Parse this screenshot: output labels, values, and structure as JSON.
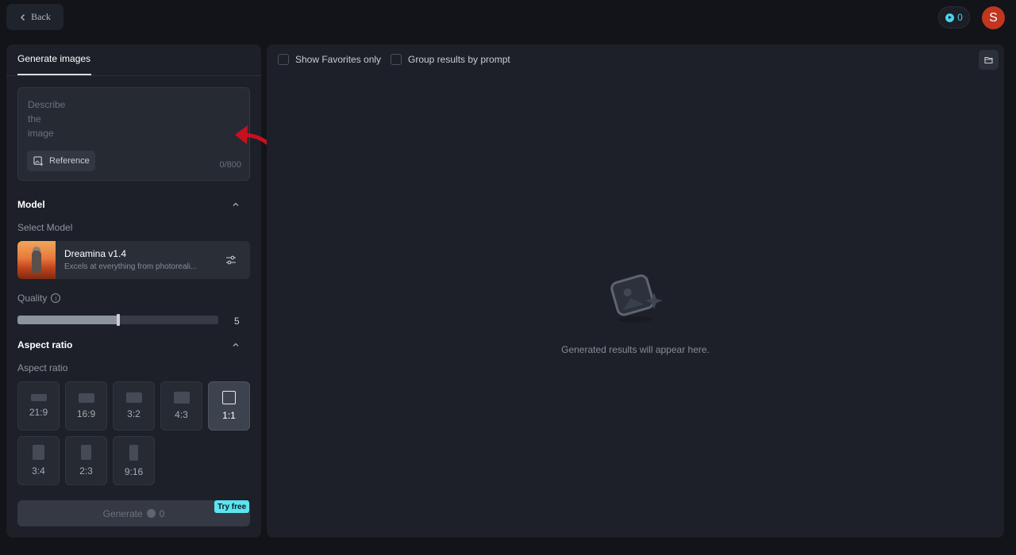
{
  "header": {
    "back_label": "Back",
    "credits": "0",
    "avatar_initial": "S"
  },
  "left_panel": {
    "tab": "Generate images",
    "prompt": {
      "placeholder": "Describe the image",
      "value": "",
      "char_count": "0/800",
      "reference_label": "Reference"
    },
    "model_section": {
      "title": "Model",
      "select_label": "Select Model",
      "model_name": "Dreamina v1.4",
      "model_description": "Excels at everything from photoreali..."
    },
    "quality": {
      "label": "Quality",
      "value": "5",
      "fraction": 0.5
    },
    "aspect_section": {
      "title": "Aspect ratio",
      "sub_label": "Aspect ratio",
      "options": [
        "21:9",
        "16:9",
        "3:2",
        "4:3",
        "1:1",
        "3:4",
        "2:3",
        "9:16"
      ],
      "selected": "1:1"
    },
    "generate": {
      "label": "Generate",
      "cost": "0",
      "badge": "Try free"
    }
  },
  "main_panel": {
    "show_favorites_label": "Show Favorites only",
    "group_results_label": "Group results by prompt",
    "empty_message": "Generated results will appear here."
  },
  "colors": {
    "background": "#121419",
    "panel": "#1d2028",
    "accent": "#5ce4f0",
    "avatar": "#c0361f",
    "annotation_arrow": "#c8101c"
  }
}
